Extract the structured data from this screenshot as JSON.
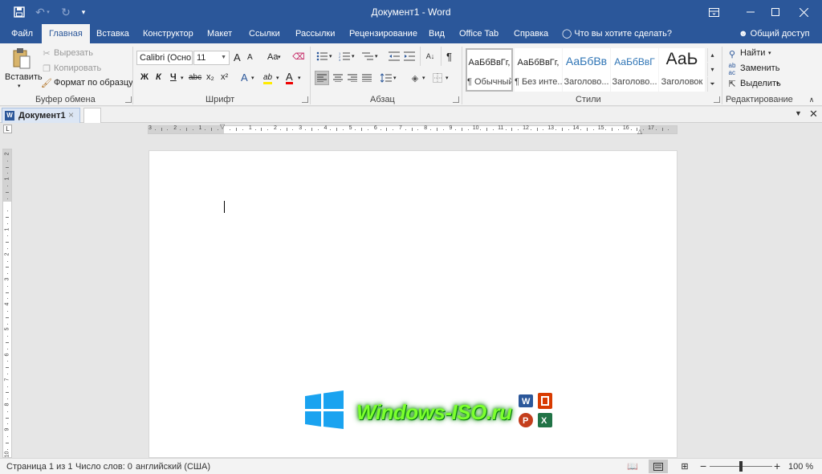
{
  "titlebar": {
    "title": "Документ1  -  Word",
    "bg_color": "#2b579a"
  },
  "quick_access": [
    "save-icon",
    "undo-icon",
    "redo-icon",
    "customize-icon"
  ],
  "menu": {
    "tabs": [
      "Файл",
      "Главная",
      "Вставка",
      "Конструктор",
      "Макет",
      "Ссылки",
      "Рассылки",
      "Рецензирование",
      "Вид",
      "Office Tab",
      "Справка"
    ],
    "active": "Главная",
    "tell_me": "Что вы хотите сделать?",
    "share": "Общий доступ"
  },
  "clipboard": {
    "paste": "Вставить",
    "cut": "Вырезать",
    "copy": "Копировать",
    "format_painter": "Формат по образцу",
    "label": "Буфер обмена"
  },
  "font": {
    "name": "Calibri (Осно",
    "size": "11",
    "bold": "Ж",
    "italic": "К",
    "underline": "Ч",
    "strike": "abc",
    "subscript": "x₂",
    "superscript": "x²",
    "case": "Aa",
    "grow": "A",
    "shrink": "A",
    "effects": "A",
    "highlight": "ab",
    "color": "A",
    "label": "Шрифт"
  },
  "paragraph": {
    "label": "Абзац",
    "pilcrow": "¶"
  },
  "styles": {
    "items": [
      {
        "preview": "АаБбВвГг,",
        "name": "¶ Обычный"
      },
      {
        "preview": "АаБбВвГг,",
        "name": "¶ Без инте..."
      },
      {
        "preview": "АаБбВв",
        "name": "Заголово..."
      },
      {
        "preview": "АаБбВвГ",
        "name": "Заголово..."
      },
      {
        "preview": "АаЬ",
        "name": "Заголовок"
      }
    ],
    "label": "Стили"
  },
  "editing": {
    "find": "Найти",
    "replace": "Заменить",
    "select": "Выделить",
    "label": "Редактирование"
  },
  "doc_tabs": {
    "active": "Документ1",
    "close": "×"
  },
  "ruler": {
    "h_labels": [
      "3",
      "2",
      "1",
      "",
      "1",
      "2",
      "3",
      "4",
      "5",
      "6",
      "7",
      "8",
      "9",
      "10",
      "11",
      "12",
      "13",
      "14",
      "15",
      "16",
      "17"
    ],
    "v_labels": [
      "2",
      "1",
      "",
      "1",
      "2",
      "3",
      "4",
      "5",
      "6",
      "7",
      "8",
      "9",
      "10"
    ]
  },
  "watermark": {
    "text": "Windows-ISO.ru"
  },
  "status": {
    "page": "Страница 1 из 1",
    "words": "Число слов: 0",
    "language": "английский (США)",
    "zoom": "100 %",
    "zoom_fraction": 0.5
  }
}
